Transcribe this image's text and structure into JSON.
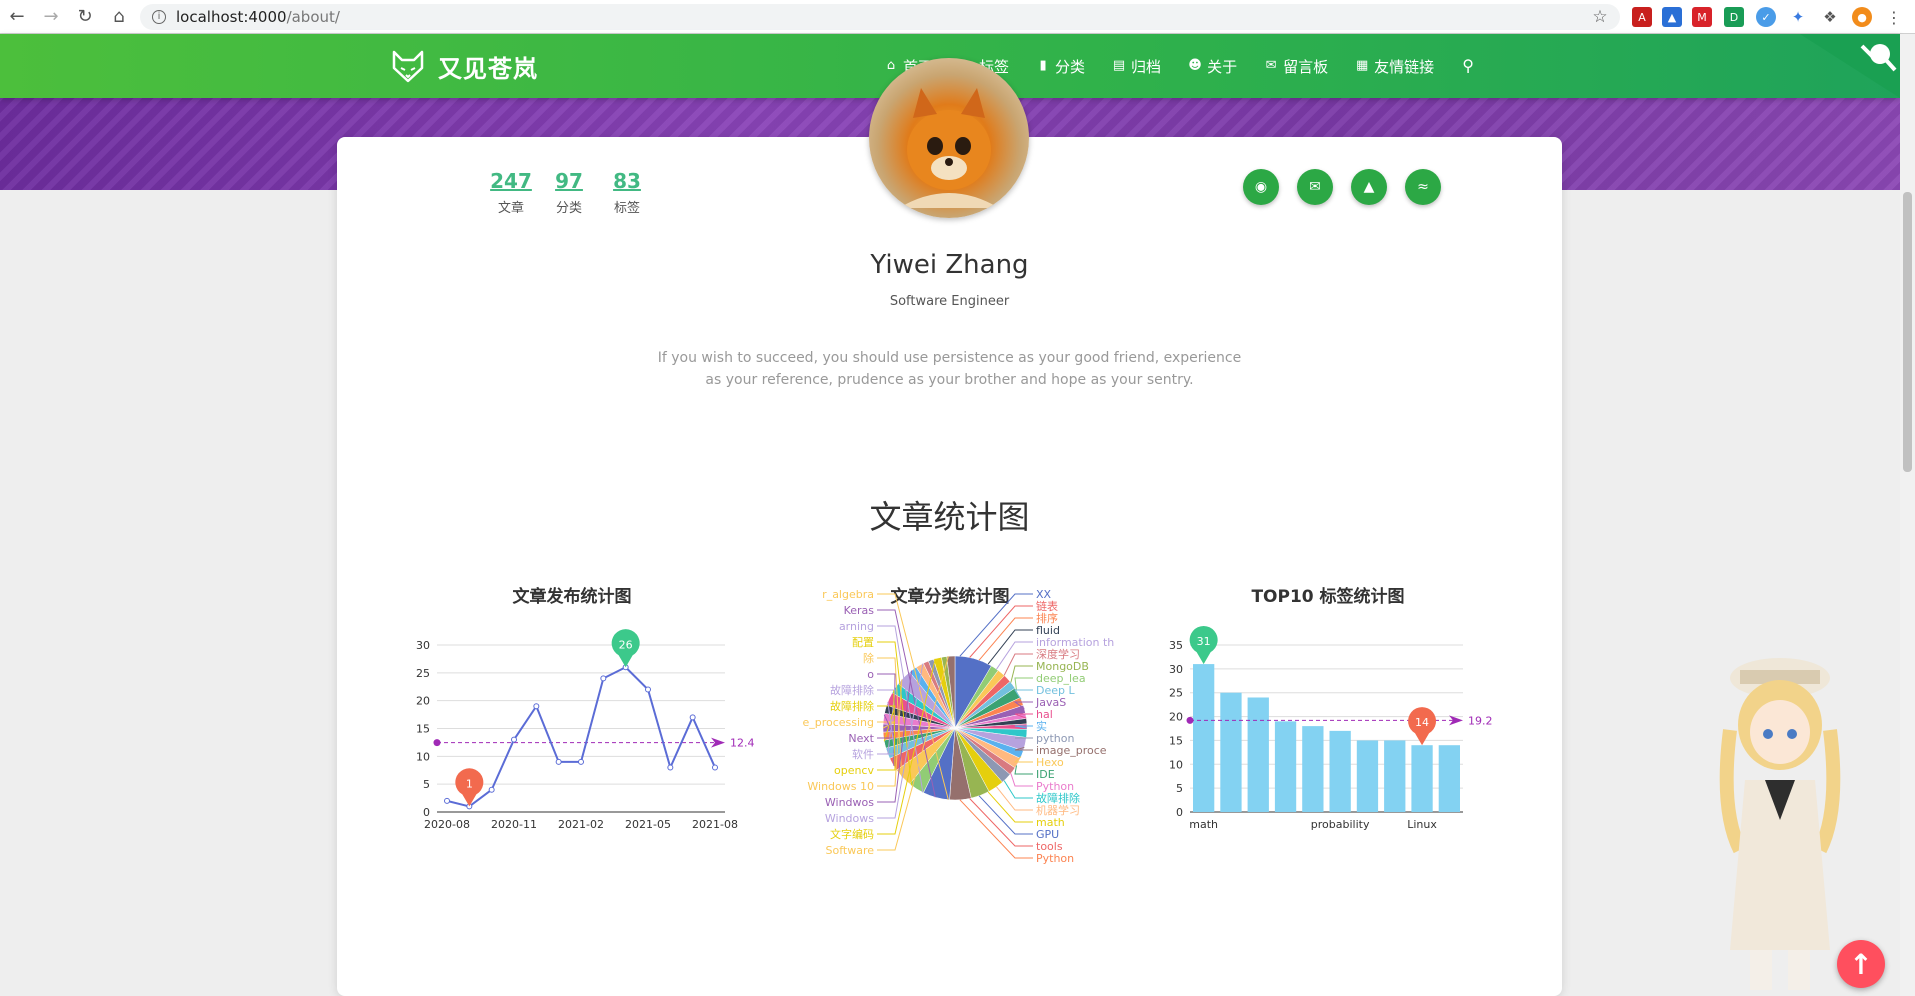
{
  "browser": {
    "url_host": "localhost:4000",
    "url_path": "/about/"
  },
  "site": {
    "brand": "又见苍岚",
    "menu": [
      "首页",
      "标签",
      "分类",
      "归档",
      "关于",
      "留言板",
      "友情链接"
    ]
  },
  "profile": {
    "stats": [
      {
        "value": "247",
        "label": "文章"
      },
      {
        "value": "97",
        "label": "分类"
      },
      {
        "value": "83",
        "label": "标签"
      }
    ],
    "name": "Yiwei Zhang",
    "role": "Software Engineer",
    "motto": "If you wish to succeed, you should use persistence as your good friend, experience as your reference, prudence as your brother and hope as your sentry."
  },
  "section_title": "文章统计图",
  "chart_data": [
    {
      "type": "line",
      "title": "文章发布统计图",
      "x_ticks": [
        "2020-08",
        "2020-11",
        "2021-02",
        "2021-05",
        "2021-08"
      ],
      "values": [
        2,
        1,
        4,
        13,
        19,
        9,
        9,
        24,
        26,
        22,
        8,
        17,
        8
      ],
      "ylim": [
        0,
        30
      ],
      "y_ticks": [
        0,
        5,
        10,
        15,
        20,
        25,
        30
      ],
      "max_label": "26",
      "min_label": "1",
      "average": 12.46,
      "average_label": "12.46",
      "color": "#5b6cd6"
    },
    {
      "type": "pie",
      "title": "文章分类统计图",
      "labels_right": [
        "XX",
        "链表",
        "排序",
        "fluid",
        "information th",
        "深度学习",
        "MongoDB",
        "deep_lea",
        "Deep L",
        "JavaS",
        "hal",
        "实",
        "python",
        "image_proce",
        "Hexo",
        "IDE",
        "Python",
        "故障排除",
        "机器学习",
        "math",
        "GPU",
        "tools",
        "Python"
      ],
      "labels_left": [
        "r_algebra",
        "Keras",
        "arning",
        "配置",
        "除",
        "o",
        "故障排除",
        "故障排除",
        "e_processing",
        "Next",
        "软件",
        "opencv",
        "Windows 10",
        "Windwos",
        "Windows",
        "文字编码",
        "Software"
      ]
    },
    {
      "type": "bar",
      "title": "TOP10 标签统计图",
      "categories": [
        "math",
        "",
        "",
        "",
        "",
        "probability",
        "",
        "",
        "Linux",
        ""
      ],
      "values": [
        31,
        25,
        24,
        19,
        18,
        17,
        15,
        15,
        14,
        14
      ],
      "ylim": [
        0,
        35
      ],
      "y_ticks": [
        0,
        5,
        10,
        15,
        20,
        25,
        30,
        35
      ],
      "max_label": "31",
      "min_label": "14",
      "average": 19.2,
      "average_label": "19.2",
      "color": "#83d2f2"
    }
  ]
}
